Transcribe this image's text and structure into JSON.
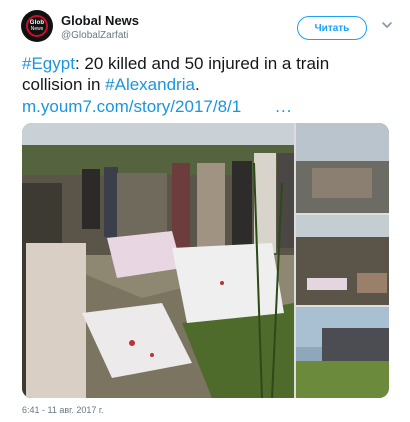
{
  "account": {
    "display_name": "Global News",
    "handle": "@GlobalZarfati",
    "avatar_line1": "Glob",
    "avatar_line2": "News"
  },
  "follow_button_label": "Читать",
  "tweet": {
    "hashtag_1": "#Egypt",
    "text_1": ": 20 killed and 50 injured in a train collision in ",
    "hashtag_2": "#Alexandria",
    "text_2": ".",
    "link": "m.youm7.com/story/2017/8/1",
    "more": "..."
  },
  "timestamp": "6:41 - 11 авг. 2017 г.",
  "icons": {
    "menu": "chevron-down-icon"
  },
  "colors": {
    "accent": "#1da1f2",
    "link": "#1b95e0",
    "text": "#14171a",
    "muted": "#657786"
  }
}
